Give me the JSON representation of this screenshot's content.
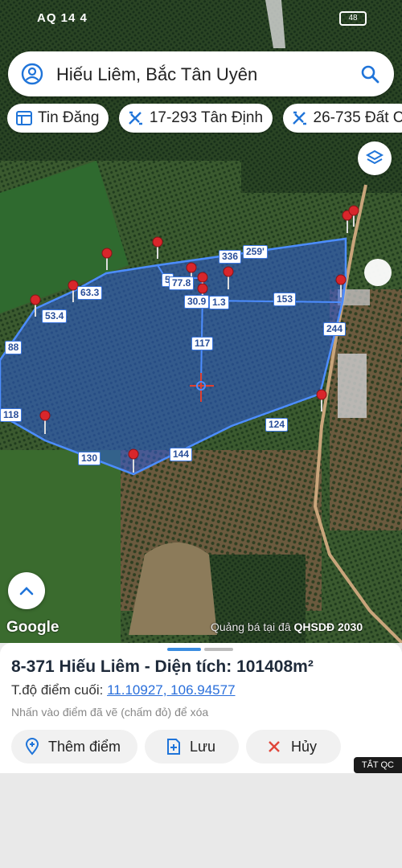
{
  "status_bar": {
    "left_text": "AQ 14 4",
    "right_text": "48"
  },
  "search": {
    "query": "Hiếu Liêm, Bắc Tân Uyên"
  },
  "chips": [
    {
      "label": "Tin Đăng",
      "icon": "listing-icon"
    },
    {
      "label": "17-293 Tân Định",
      "icon": "plot-icon"
    },
    {
      "label": "26-735 Đất C",
      "icon": "plot-icon"
    }
  ],
  "edges": [
    "336",
    "259'",
    "5",
    "77.8",
    "30.9",
    "1.3",
    "153",
    "63.3",
    "53.4",
    "88",
    "117",
    "244",
    "118",
    "124",
    "130",
    "144"
  ],
  "map": {
    "google_label": "Google",
    "promo_text": "Quảng bá tại đâ",
    "promo_code": "QHSDĐ 2030"
  },
  "panel": {
    "title": "8-371 Hiếu Liêm - Diện tích: 101408m²",
    "coord_label": "T.độ điểm cuối:",
    "coord_value": "11.10927, 106.94577",
    "hint": "Nhấn vào điểm đã vẽ (chấm đỏ) để xóa",
    "btn_add": "Thêm điểm",
    "btn_save": "Lưu",
    "btn_cancel": "Hủy"
  },
  "ad_close": "TẮT QC",
  "colors": {
    "polygon_fill": "#2e5bd8",
    "polygon_stroke": "#4c8dff",
    "pin": "#d8262b",
    "link": "#2a6fdb"
  }
}
